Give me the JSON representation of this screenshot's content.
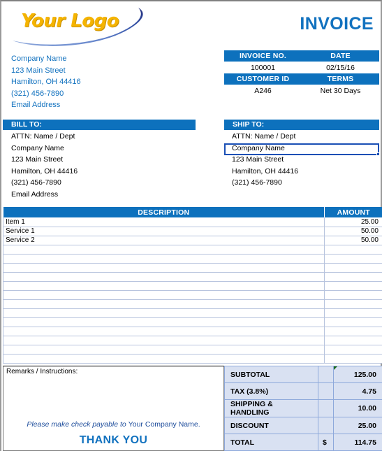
{
  "document": {
    "type": "invoice",
    "title": "INVOICE"
  },
  "logo": {
    "text": "Your Logo",
    "gold": "#F5B400",
    "swoosh_dark": "#2C3E8F",
    "swoosh_light": "#7D9BD6"
  },
  "colors": {
    "header_blue": "#0D71BD",
    "text_blue": "#1272BF",
    "totals_fill": "#D9E1F2",
    "totals_border": "#8EA9DB",
    "grid_line": "#B8C4DE",
    "selection_border": "#1A4FB5"
  },
  "company": {
    "lines": [
      "Company Name",
      "123 Main Street",
      "Hamilton, OH  44416",
      "(321) 456-7890",
      "Email Address"
    ]
  },
  "meta": {
    "rows": [
      {
        "label_left": "INVOICE NO.",
        "label_right": "DATE",
        "value_left": "100001",
        "value_right": "02/15/16"
      },
      {
        "label_left": "CUSTOMER ID",
        "label_right": "TERMS",
        "value_left": "A246",
        "value_right": "Net 30 Days"
      }
    ]
  },
  "bill_to": {
    "heading": "BILL TO:",
    "lines": [
      "ATTN: Name / Dept",
      "Company Name",
      "123 Main Street",
      "Hamilton, OH  44416",
      "(321) 456-7890",
      "Email Address"
    ]
  },
  "ship_to": {
    "heading": "SHIP TO:",
    "lines": [
      "ATTN: Name / Dept",
      "Company Name",
      "123 Main Street",
      "Hamilton, OH  44416",
      "(321) 456-7890",
      "",
      ""
    ],
    "selected_line_index": 1
  },
  "items": {
    "headers": {
      "description": "DESCRIPTION",
      "amount": "AMOUNT"
    },
    "rows": [
      {
        "description": "Item 1",
        "amount": "25.00"
      },
      {
        "description": "Service 1",
        "amount": "50.00"
      },
      {
        "description": "Service 2",
        "amount": "50.00"
      },
      {
        "description": "",
        "amount": ""
      },
      {
        "description": "",
        "amount": ""
      },
      {
        "description": "",
        "amount": ""
      },
      {
        "description": "",
        "amount": ""
      },
      {
        "description": "",
        "amount": ""
      },
      {
        "description": "",
        "amount": ""
      },
      {
        "description": "",
        "amount": ""
      },
      {
        "description": "",
        "amount": ""
      },
      {
        "description": "",
        "amount": ""
      },
      {
        "description": "",
        "amount": ""
      },
      {
        "description": "",
        "amount": ""
      },
      {
        "description": "",
        "amount": ""
      },
      {
        "description": "",
        "amount": ""
      }
    ]
  },
  "remarks": {
    "label": "Remarks / Instructions:",
    "value": "",
    "payable_italic": "Please make check payable to ",
    "payable_name": "Your Company Name.",
    "thank_you": "THANK YOU"
  },
  "totals": {
    "rows": [
      {
        "label": "SUBTOTAL",
        "currency": "",
        "value": "125.00",
        "has_comment_marker": true
      },
      {
        "label": "TAX (3.8%)",
        "currency": "",
        "value": "4.75",
        "has_comment_marker": false
      },
      {
        "label": "SHIPPING & HANDLING",
        "currency": "",
        "value": "10.00",
        "has_comment_marker": false
      },
      {
        "label": "DISCOUNT",
        "currency": "",
        "value": "25.00",
        "has_comment_marker": false
      },
      {
        "label": "TOTAL",
        "currency": "$",
        "value": "114.75",
        "has_comment_marker": false
      }
    ]
  }
}
